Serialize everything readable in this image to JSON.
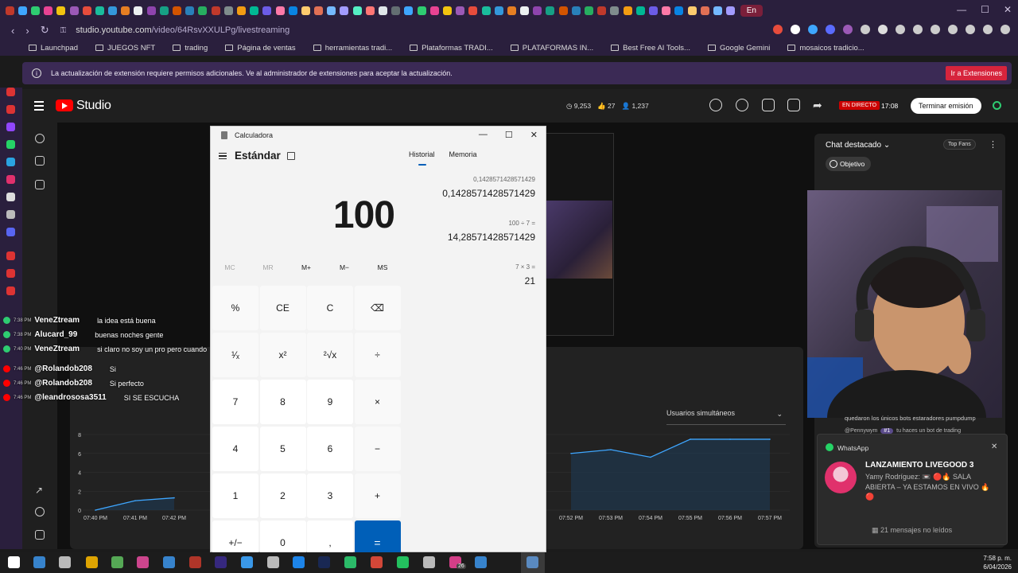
{
  "browser": {
    "active_tab_label": "En",
    "url_host": "studio.youtube.com",
    "url_path": "/video/64RsvXXULPg/livestreaming",
    "bookmarks": [
      "Launchpad",
      "JUEGOS NFT",
      "trading",
      "Página de ventas",
      "herramientas tradi...",
      "Plataformas TRADI...",
      "PLATAFORMAS IN...",
      "Best Free AI Tools...",
      "Google Gemini",
      "mosaicos tradicio..."
    ],
    "notice_text": "La actualización de extensión requiere permisos adicionales. Ve al administrador de extensiones para aceptar la actualización.",
    "notice_button": "Ir a Extensiones"
  },
  "studio": {
    "logo_text": "Studio",
    "stats": {
      "viewers": "9,253",
      "likes": "27",
      "subs": "1,237"
    },
    "live_badge": "EN DIRECTO",
    "live_time": "17:08",
    "end_button": "Terminar emisión"
  },
  "overlay_chat": [
    {
      "time": "7:38 PM",
      "user": "VeneZtream",
      "msg": "la idea está buena",
      "color": "#2ecc71"
    },
    {
      "time": "7:38 PM",
      "user": "Alucard_99",
      "msg": "buenas noches gente",
      "color": "#2ecc71"
    },
    {
      "time": "7:40 PM",
      "user": "VeneZtream",
      "msg": "si claro no soy un pro pero cuando",
      "color": "#2ecc71"
    },
    {
      "time": "7:46 PM",
      "user": "@Rolandob208",
      "msg": "Si",
      "color": "#ff0000"
    },
    {
      "time": "7:46 PM",
      "user": "@Rolandob208",
      "msg": "Si perfecto",
      "color": "#ff0000"
    },
    {
      "time": "7:46 PM",
      "user": "@leandrososa3511",
      "msg": "SI SE ESCUCHA",
      "color": "#ff0000"
    }
  ],
  "chart_data": {
    "type": "area",
    "title": "",
    "metric_selector": "Usuarios simultáneos",
    "x": [
      "07:40 PM",
      "07:41 PM",
      "07:42 PM",
      "07:52 PM",
      "07:53 PM",
      "07:54 PM",
      "07:55 PM",
      "07:56 PM",
      "07:57 PM"
    ],
    "y_ticks": [
      0,
      2,
      4,
      6,
      8
    ],
    "ylim": [
      0,
      8
    ],
    "visible_left": {
      "x": [
        "07:40 PM",
        "07:41 PM",
        "07:42 PM"
      ],
      "values": [
        0,
        1,
        1.3
      ]
    },
    "visible_right": {
      "x": [
        "07:52 PM",
        "07:53 PM",
        "07:54 PM",
        "07:55 PM",
        "07:56 PM",
        "07:57 PM"
      ],
      "values": [
        6,
        6.4,
        5.6,
        7.5,
        7.5,
        7.5
      ]
    },
    "grid": true,
    "colors": {
      "line": "#3ea6ff",
      "fill": "#1e3a55"
    }
  },
  "chat": {
    "title": "Chat destacado",
    "top_fans": "Top Fans",
    "goal_button": "Objetivo",
    "msg1": "quedaron los únicos bots estaradores pumpdump",
    "msg2_user": "@Pennywym",
    "msg2_badge": "#1",
    "msg2_text": "tu haces un bot de trading"
  },
  "toast": {
    "app": "WhatsApp",
    "title": "LANZAMIENTO LIVEGOOD 3",
    "body": "Yamy Rodríguez: 📼 🔴🔥 SALA ABIERTA – YA ESTAMOS EN VIVO 🔥🔴",
    "footer": "21 mensajes no leídos"
  },
  "calculator": {
    "title": "Calculadora",
    "mode": "Estándar",
    "display": "100",
    "tab_history": "Historial",
    "tab_memory": "Memoria",
    "memory_keys": [
      "MC",
      "MR",
      "M+",
      "M−",
      "MS"
    ],
    "history": [
      {
        "expr": "0,1428571428571429",
        "result": "0,1428571428571429"
      },
      {
        "expr": "100  ÷  7 =",
        "result": "14,28571428571429"
      },
      {
        "expr": "7  ×  3 =",
        "result": "21"
      }
    ],
    "keys": [
      [
        "%",
        "CE",
        "C",
        "⌫"
      ],
      [
        "¹⁄ₓ",
        "x²",
        "²√x",
        "÷"
      ],
      [
        "7",
        "8",
        "9",
        "×"
      ],
      [
        "4",
        "5",
        "6",
        "−"
      ],
      [
        "1",
        "2",
        "3",
        "+"
      ],
      [
        "+/−",
        "0",
        ",",
        "="
      ]
    ]
  },
  "taskbar": {
    "time": "7:58 p. m.",
    "date": "6/04/2026",
    "badge": "26"
  }
}
